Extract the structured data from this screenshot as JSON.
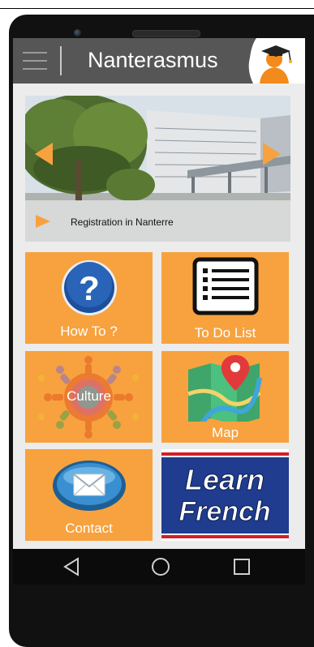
{
  "app": {
    "title": "Nanterasmus"
  },
  "slider": {
    "caption": "Registration in Nanterre"
  },
  "tiles": [
    {
      "label": "How To ?",
      "icon": "question-mark-icon"
    },
    {
      "label": "To Do List",
      "icon": "checklist-icon"
    },
    {
      "label": "Culture",
      "icon": "globe-people-icon"
    },
    {
      "label": "Map",
      "icon": "map-pin-icon"
    },
    {
      "label": "Contact",
      "icon": "envelope-icon"
    },
    {
      "label": "",
      "icon": "learn-french-logo"
    }
  ],
  "learn_french": {
    "line1": "Learn",
    "line2": "French"
  },
  "nav": {
    "back_icon": "triangle-back-icon",
    "home_icon": "circle-home-icon",
    "recents_icon": "square-recents-icon"
  },
  "colors": {
    "tile_orange": "#f7a23e",
    "header_gray": "#565656",
    "learn_blue": "#1f3c8f",
    "learn_red": "#d21f26"
  }
}
